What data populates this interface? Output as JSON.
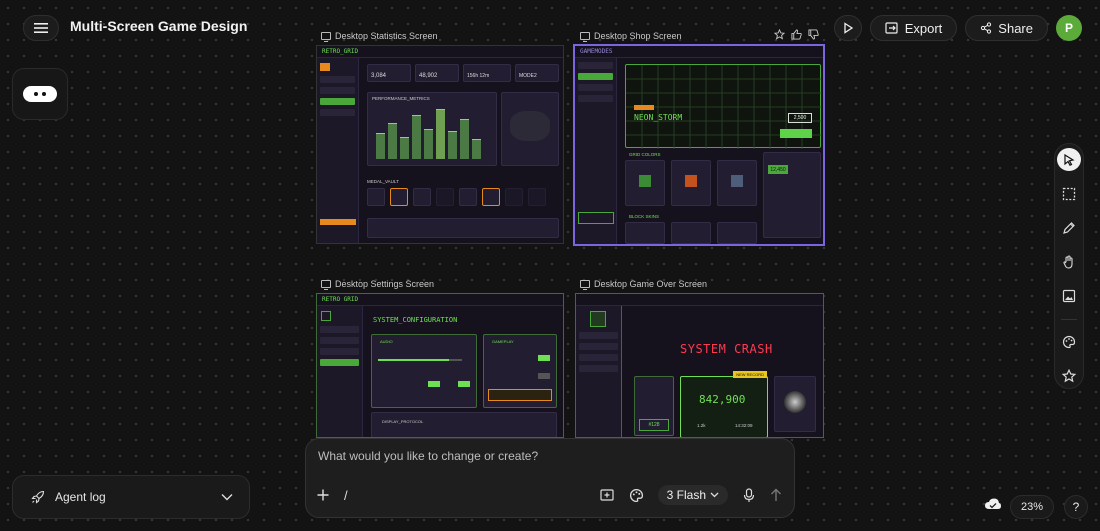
{
  "header": {
    "title": "Multi-Screen Game Design",
    "export_label": "Export",
    "share_label": "Share",
    "avatar_initial": "P"
  },
  "screens": [
    {
      "label": "Desktop Statistics Screen",
      "brand": "RETRO_GRID",
      "section_1": "PERFORMANCE_METRICS",
      "section_2": "MEDAL_VAULT",
      "stats": [
        "3,084",
        "48,902",
        "156h 12m",
        "MODE2"
      ]
    },
    {
      "label": "Desktop Shop Screen",
      "brand": "GAMEMODES",
      "hero_title": "NEON_STORM",
      "hero_price": "2,500",
      "section_1": "GRID COLORS",
      "section_2": "BLOCK SKINS",
      "balance": "12,450"
    },
    {
      "label": "Desktop Settings Screen",
      "brand": "RETRO GRID",
      "heading": "SYSTEM_CONFIGURATION",
      "panel_1": "AUDIO",
      "panel_2": "GAMEPLAY",
      "panel_3": "DISPLAY_PROTOCOL"
    },
    {
      "label": "Desktop Game Over Screen",
      "heading": "SYSTEM CRASH",
      "score": "842,900",
      "level": "#128",
      "time": "14:32:09",
      "ratio": "1.2k",
      "badge": "NEW RECORD"
    }
  ],
  "prompt": {
    "placeholder": "What would you like to change or create?",
    "slash": "/",
    "model": "3 Flash"
  },
  "agent_log": {
    "label": "Agent log"
  },
  "zoom": {
    "value": "23%"
  },
  "help": "?",
  "icons": {
    "menu": "hamburger-icon",
    "chat": "chat-bubble-icon",
    "play": "play-icon",
    "export": "export-icon",
    "share": "share-icon",
    "tools": [
      "cursor-icon",
      "select-icon",
      "pencil-icon",
      "hand-icon",
      "image-icon",
      "palette-icon",
      "star-icon"
    ]
  },
  "colors": {
    "accent_selected": "#7b65e0",
    "neon_green": "#6fe053",
    "orange": "#e8891f",
    "crash_red": "#ff3a4f",
    "avatar": "#5caa3a"
  }
}
